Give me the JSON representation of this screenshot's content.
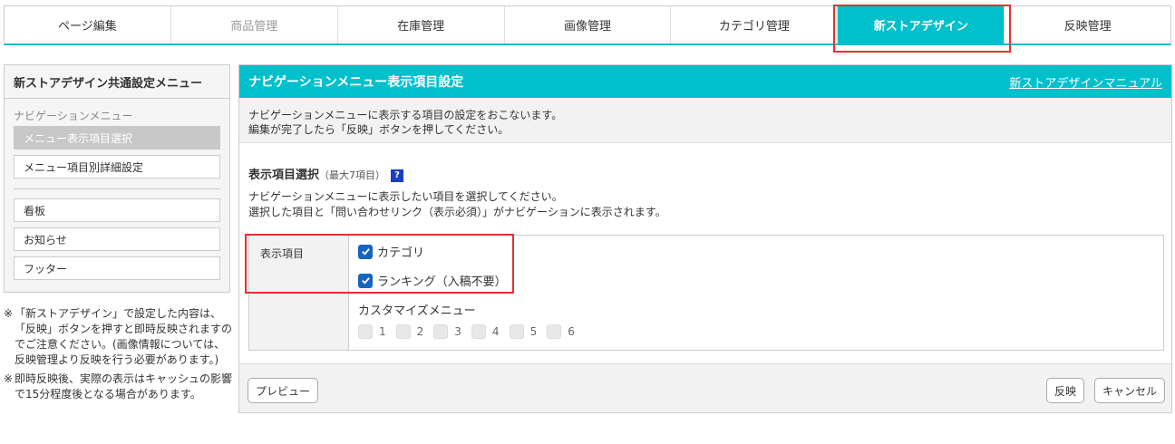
{
  "tabs": [
    {
      "label": "ページ編集",
      "state": "normal"
    },
    {
      "label": "商品管理",
      "state": "disabled"
    },
    {
      "label": "在庫管理",
      "state": "normal"
    },
    {
      "label": "画像管理",
      "state": "normal"
    },
    {
      "label": "カテゴリ管理",
      "state": "normal"
    },
    {
      "label": "新ストアデザイン",
      "state": "active"
    },
    {
      "label": "反映管理",
      "state": "normal"
    }
  ],
  "sidebar": {
    "title": "新ストアデザイン共通設定メニュー",
    "subtitle": "ナビゲーションメニュー",
    "items": [
      {
        "label": "メニュー表示項目選択"
      },
      {
        "label": "メニュー項目別詳細設定"
      },
      {
        "label": "看板"
      },
      {
        "label": "お知らせ"
      },
      {
        "label": "フッター"
      }
    ]
  },
  "notes": [
    {
      "mark": "※",
      "text": "「新ストアデザイン」で設定した内容は、「反映」ボタンを押すと即時反映されますのでご注意ください。(画像情報については、反映管理より反映を行う必要があります。)"
    },
    {
      "mark": "※",
      "text": "即時反映後、実際の表示はキャッシュの影響で15分程度後となる場合があります。"
    }
  ],
  "panel": {
    "title": "ナビゲーションメニュー表示項目設定",
    "manual_link": "新ストアデザインマニュアル",
    "desc_line1": "ナビゲーションメニューに表示する項目の設定をおこないます。",
    "desc_line2": "編集が完了したら「反映」ボタンを押してください。",
    "section_title": "表示項目選択",
    "section_limit": "（最大7項目）",
    "help_icon": "?",
    "section_desc1": "ナビゲーションメニューに表示したい項目を選択してください。",
    "section_desc2": "選択した項目と「問い合わせリンク（表示必須）」がナビゲーションに表示されます。",
    "table_label": "表示項目",
    "options": [
      {
        "label": "カテゴリ",
        "checked": true
      },
      {
        "label": "ランキング（入稿不要）",
        "checked": true
      }
    ],
    "custom_label": "カスタマイズメニュー",
    "custom_items": [
      {
        "label": "1",
        "checked": false
      },
      {
        "label": "2",
        "checked": false
      },
      {
        "label": "3",
        "checked": false
      },
      {
        "label": "4",
        "checked": false
      },
      {
        "label": "5",
        "checked": false
      },
      {
        "label": "6",
        "checked": false
      }
    ],
    "preview_button": "プレビュー",
    "apply_button": "反映",
    "cancel_button": "キャンセル"
  },
  "colors": {
    "accent": "#00c0cc",
    "highlight": "#e53030",
    "checkbox": "#1565c0"
  }
}
